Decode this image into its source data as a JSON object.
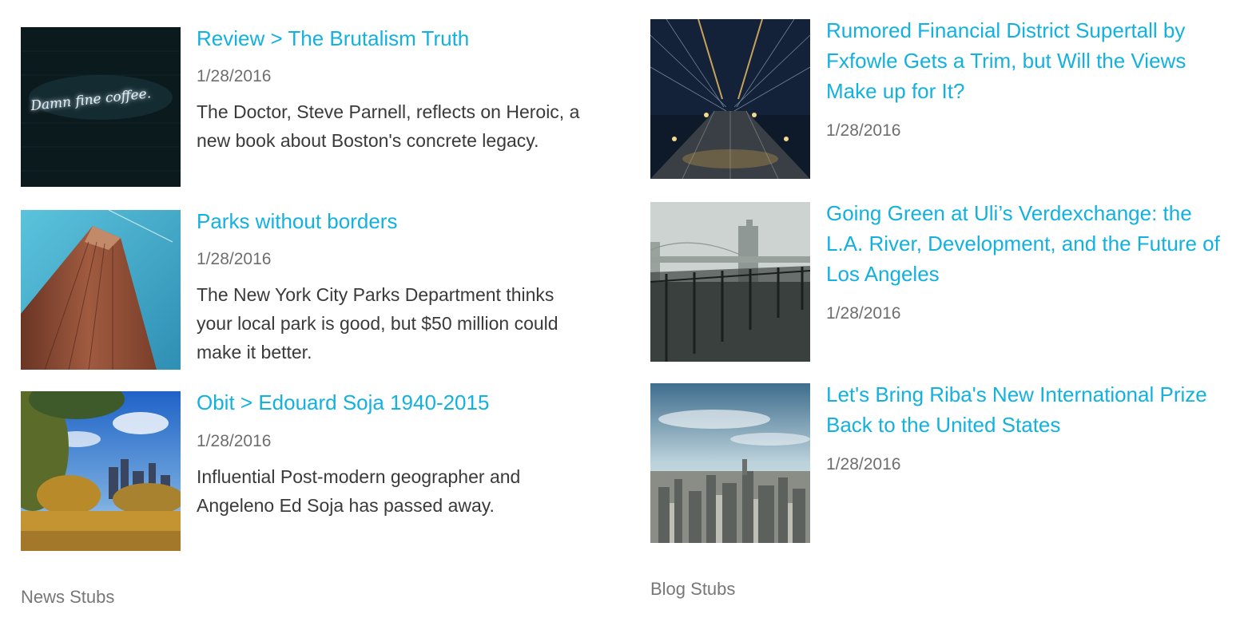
{
  "news": {
    "label": "News Stubs",
    "items": [
      {
        "title": "Review > The Brutalism Truth",
        "date": "1/28/2016",
        "description": "The Doctor, Steve Parnell, reflects on Heroic, a new book about Boston's concrete legacy.",
        "image": "neon-sign-coffee-image",
        "image_text": "Damn fine coffee."
      },
      {
        "title": "Parks without borders",
        "date": "1/28/2016",
        "description": "The New York City Parks Department thinks your local park is good, but $50 million could make it better.",
        "image": "skyscraper-image"
      },
      {
        "title": "Obit > Edouard Soja 1940-2015",
        "date": "1/28/2016",
        "description": "Influential Post-modern geographer and Angeleno Ed Soja has passed away.",
        "image": "autumn-park-skyline-image"
      }
    ]
  },
  "blog": {
    "label": "Blog Stubs",
    "items": [
      {
        "title": "Rumored Financial District Supertall by Fxfowle Gets a Trim, but Will the Views Make up for It?",
        "date": "1/28/2016",
        "image": "bridge-walkway-night-image"
      },
      {
        "title": "Going Green at Uli’s Verdexchange: the L.A. River, Development, and the Future of Los Angeles",
        "date": "1/28/2016",
        "image": "foggy-waterfront-image"
      },
      {
        "title": "Let's Bring Riba's New International Prize Back to the United States",
        "date": "1/28/2016",
        "image": "city-aerial-image"
      }
    ]
  },
  "colors": {
    "link": "#13b1e0",
    "date": "#6e6e6e",
    "body_text": "#3a3a3a",
    "label": "#777777"
  }
}
